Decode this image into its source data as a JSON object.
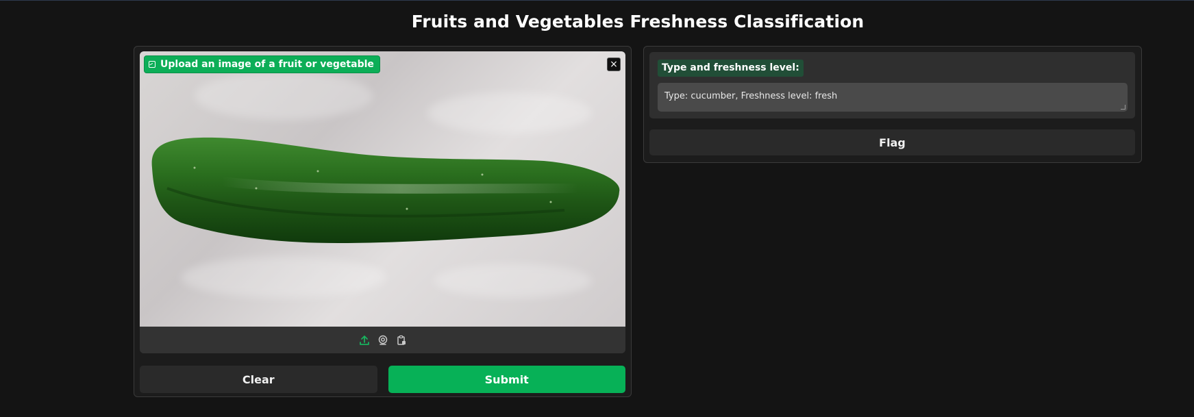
{
  "page": {
    "title": "Fruits and Vegetables Freshness Classification"
  },
  "input": {
    "upload_label": "Upload an image of a fruit or vegetable",
    "close_symbol": "×",
    "source_icons": [
      "upload-icon",
      "webcam-icon",
      "clipboard-icon"
    ],
    "image_subject": "cucumber"
  },
  "buttons": {
    "clear": "Clear",
    "submit": "Submit",
    "flag": "Flag"
  },
  "output": {
    "label": "Type and freshness level:",
    "value": "Type: cucumber,  Freshness level: fresh"
  },
  "colors": {
    "background": "#141414",
    "accent_green": "#07b157",
    "label_green": "#214e37",
    "panel": "#1c1c1c"
  }
}
